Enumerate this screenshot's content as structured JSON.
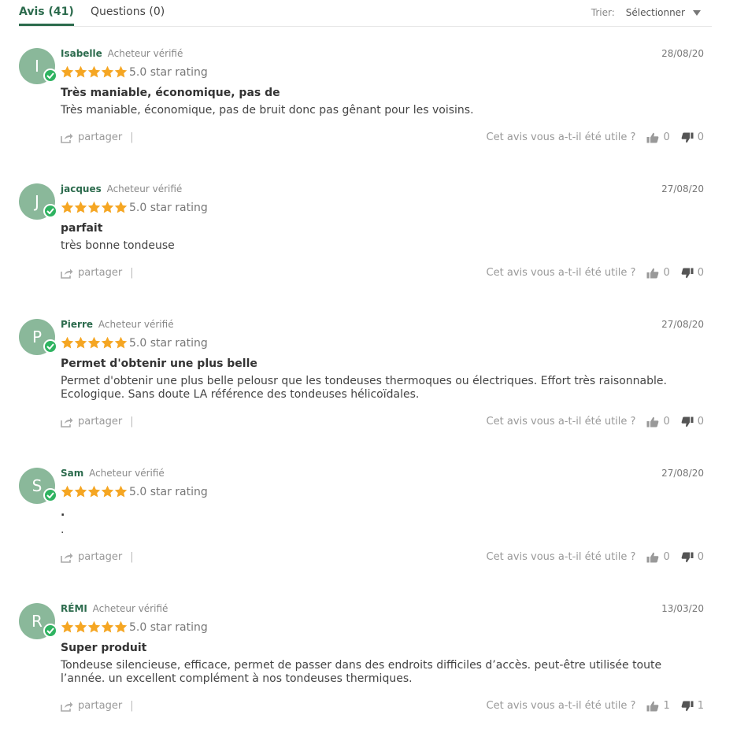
{
  "tabs": {
    "reviews": "Avis (41)",
    "questions": "Questions (0)"
  },
  "sort": {
    "label": "Trier:",
    "value": "Sélectionner"
  },
  "colors": {
    "accent": "#2c6b4d",
    "star": "#f5a623",
    "avatar": "#8ab89a",
    "verified_badge": "#2fb361"
  },
  "review_common": {
    "verified_label": "Acheteur vérifié",
    "share_label": "partager",
    "share_separator": "|",
    "helpful_question": "Cet avis vous a-t-il été utile ?"
  },
  "reviews": [
    {
      "initial": "I",
      "name": "Isabelle",
      "date": "28/08/20",
      "rating": 5,
      "rating_text": "5.0 star rating",
      "title": "Très maniable, économique, pas de",
      "body": "Très maniable, économique, pas de bruit donc pas gênant pour les voisins.",
      "thumbs_up": "0",
      "thumbs_down": "0"
    },
    {
      "initial": "J",
      "name": "jacques",
      "date": "27/08/20",
      "rating": 5,
      "rating_text": "5.0 star rating",
      "title": "parfait",
      "body": "très bonne tondeuse",
      "thumbs_up": "0",
      "thumbs_down": "0"
    },
    {
      "initial": "P",
      "name": "Pierre",
      "date": "27/08/20",
      "rating": 5,
      "rating_text": "5.0 star rating",
      "title": "Permet d'obtenir une plus belle",
      "body": "Permet d'obtenir une plus belle pelousr que les tondeuses thermoques ou électriques. Effort très raisonnable. Ecologique. Sans doute LA référence des tondeuses hélicoïdales.",
      "thumbs_up": "0",
      "thumbs_down": "0"
    },
    {
      "initial": "S",
      "name": "Sam",
      "date": "27/08/20",
      "rating": 5,
      "rating_text": "5.0 star rating",
      "title": ".",
      "body": ".",
      "thumbs_up": "0",
      "thumbs_down": "0"
    },
    {
      "initial": "R",
      "name": "RÉMI",
      "date": "13/03/20",
      "rating": 5,
      "rating_text": "5.0 star rating",
      "title": "Super produit",
      "body": "Tondeuse silencieuse, efficace, permet de passer dans des endroits difficiles d’accès. peut-être utilisée toute l’année. un excellent complément à nos tondeuses thermiques.",
      "thumbs_up": "1",
      "thumbs_down": "1"
    }
  ]
}
